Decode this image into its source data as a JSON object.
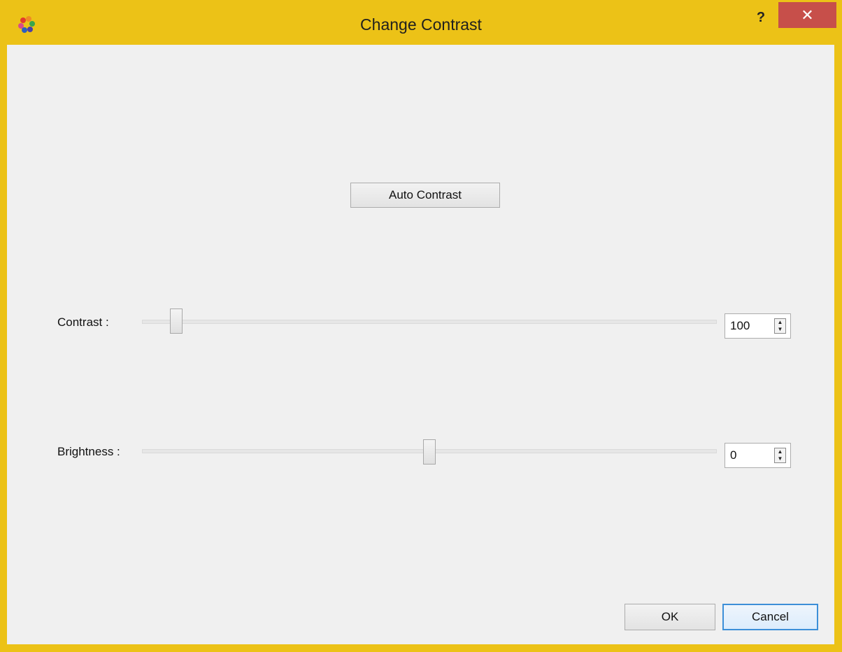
{
  "window": {
    "title": "Change Contrast",
    "icon": "app-logo-icon",
    "help_label": "?",
    "close_label": "✕",
    "accent_color": "#ecc217",
    "close_color": "#c74f4a"
  },
  "auto_contrast": {
    "label": "Auto Contrast"
  },
  "contrast": {
    "label": "Contrast :",
    "value": "100",
    "slider_fraction": 0.05
  },
  "brightness": {
    "label": "Brightness :",
    "value": "0",
    "slider_fraction": 0.5
  },
  "buttons": {
    "ok_label": "OK",
    "cancel_label": "Cancel"
  }
}
